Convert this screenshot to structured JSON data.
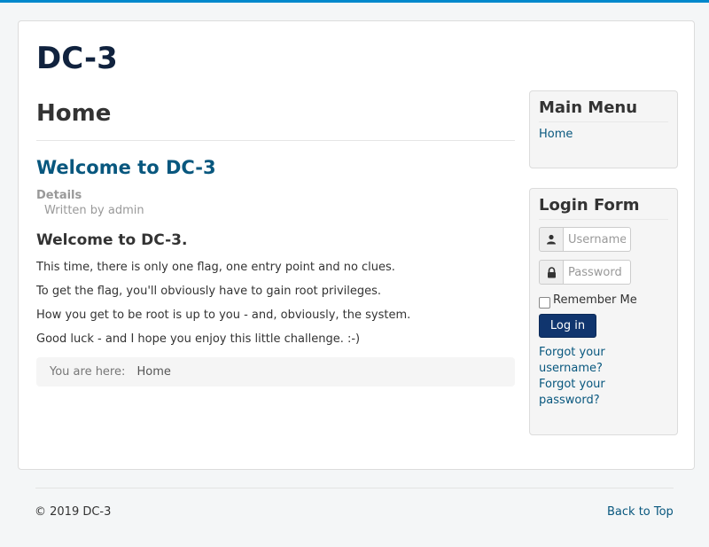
{
  "site": {
    "title": "DC-3"
  },
  "main": {
    "page_title": "Home",
    "article": {
      "title": "Welcome to DC-3",
      "details_label": "Details",
      "written_by": "Written by admin",
      "heading": "Welcome to DC-3.",
      "paragraphs": [
        "This time, there is only one flag, one entry point and no clues.",
        "To get the flag, you'll obviously have to gain root privileges.",
        "How you get to be root is up to you - and, obviously, the system.",
        "Good luck - and I hope you enjoy this little challenge.  :-)"
      ]
    },
    "breadcrumb": {
      "label": "You are here:",
      "items": [
        "Home"
      ]
    }
  },
  "sidebar": {
    "main_menu": {
      "title": "Main Menu",
      "items": [
        "Home"
      ]
    },
    "login_form": {
      "title": "Login Form",
      "username_placeholder": "Username",
      "password_placeholder": "Password",
      "remember_me": "Remember Me",
      "login_button": "Log in",
      "forgot_username": "Forgot your username?",
      "forgot_password": "Forgot your password?",
      "icons": {
        "user": "user-icon",
        "lock": "lock-icon"
      }
    }
  },
  "footer": {
    "copyright": "© 2019 DC-3",
    "back_to_top": "Back to Top"
  },
  "colors": {
    "accent": "#0088cc",
    "link": "#08577e",
    "button": "#10356e",
    "brand": "#10223e"
  }
}
